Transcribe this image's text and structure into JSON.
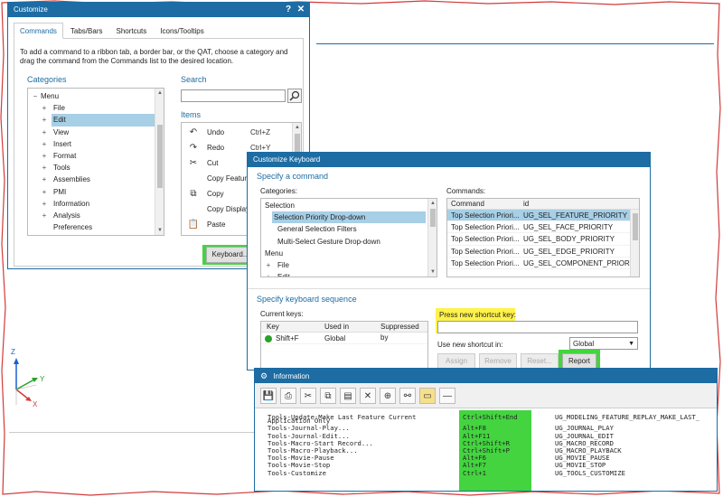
{
  "customize": {
    "title": "Customize",
    "help_btn": "?",
    "close_btn": "✕",
    "tabs": [
      "Commands",
      "Tabs/Bars",
      "Shortcuts",
      "Icons/Tooltips"
    ],
    "instructions": "To add a command to a ribbon tab, a border bar, or the QAT, choose a category and drag the command from the Commands list to the desired location.",
    "categories_header": "Categories",
    "categories": [
      {
        "label": "Menu",
        "indent": 0,
        "expander": "−"
      },
      {
        "label": "File",
        "indent": 1,
        "expander": "+"
      },
      {
        "label": "Edit",
        "indent": 1,
        "expander": "+",
        "selected": true
      },
      {
        "label": "View",
        "indent": 1,
        "expander": "+"
      },
      {
        "label": "Insert",
        "indent": 1,
        "expander": "+"
      },
      {
        "label": "Format",
        "indent": 1,
        "expander": "+"
      },
      {
        "label": "Tools",
        "indent": 1,
        "expander": "+"
      },
      {
        "label": "Assemblies",
        "indent": 1,
        "expander": "+"
      },
      {
        "label": "PMI",
        "indent": 1,
        "expander": "+"
      },
      {
        "label": "Information",
        "indent": 1,
        "expander": "+"
      },
      {
        "label": "Analysis",
        "indent": 1,
        "expander": "+"
      },
      {
        "label": "Preferences",
        "indent": 1,
        "expander": ""
      }
    ],
    "search_header": "Search",
    "search_value": "",
    "items_header": "Items",
    "items": [
      {
        "icon": "↶",
        "icon_name": "undo-icon",
        "label": "Undo",
        "shortcut": "Ctrl+Z"
      },
      {
        "icon": "↷",
        "icon_name": "redo-icon",
        "label": "Redo",
        "shortcut": "Ctrl+Y"
      },
      {
        "icon": "✂",
        "icon_name": "cut-icon",
        "label": "Cut",
        "shortcut": ""
      },
      {
        "icon": "",
        "icon_name": "copy-feature-icon",
        "label": "Copy Feature",
        "shortcut": ""
      },
      {
        "icon": "⧉",
        "icon_name": "copy-icon",
        "label": "Copy",
        "shortcut": ""
      },
      {
        "icon": "",
        "icon_name": "copy-display-icon",
        "label": "Copy Display",
        "shortcut": ""
      },
      {
        "icon": "📋",
        "icon_name": "paste-icon",
        "label": "Paste",
        "shortcut": ""
      }
    ],
    "keyboard_button": "Keyboard..."
  },
  "keyboard": {
    "title": "Customize Keyboard",
    "specify_command": "Specify a command",
    "categories_label": "Categories:",
    "categories": [
      {
        "label": "Selection",
        "indent": 0
      },
      {
        "label": "Selection Priority Drop-down",
        "indent": 1,
        "selected": true
      },
      {
        "label": "General Selection Filters",
        "indent": 1
      },
      {
        "label": "Multi-Select Gesture Drop-down",
        "indent": 1
      },
      {
        "label": "Menu",
        "indent": 0
      },
      {
        "label": "File",
        "indent": 1,
        "expander": "+"
      },
      {
        "label": "Edit",
        "indent": 1,
        "expander": "+"
      }
    ],
    "commands_label": "Commands:",
    "commands_headers": [
      "Command",
      "id"
    ],
    "commands": [
      {
        "command": "Top Selection Priori...",
        "id": "UG_SEL_FEATURE_PRIORITY",
        "selected": true
      },
      {
        "command": "Top Selection Priori...",
        "id": "UG_SEL_FACE_PRIORITY"
      },
      {
        "command": "Top Selection Priori...",
        "id": "UG_SEL_BODY_PRIORITY"
      },
      {
        "command": "Top Selection Priori...",
        "id": "UG_SEL_EDGE_PRIORITY"
      },
      {
        "command": "Top Selection Priori...",
        "id": "UG_SEL_COMPONENT_PRIOR..."
      }
    ],
    "specify_sequence": "Specify keyboard sequence",
    "current_keys_label": "Current keys:",
    "keys_headers": [
      "Key",
      "Used in",
      "Suppressed by"
    ],
    "keys": [
      {
        "key": "Shift+F",
        "used_in": "Global",
        "suppressed_by": ""
      }
    ],
    "press_new_label": "Press new shortcut key:",
    "new_shortcut_value": "",
    "use_in_label": "Use new shortcut in:",
    "use_in_value": "Global",
    "buttons": {
      "assign": "Assign",
      "remove": "Remove",
      "reset": "Reset...",
      "report": "Report"
    }
  },
  "info": {
    "title": "Information",
    "rows": [
      {
        "name": "Tools-Update-Make Last Feature Current",
        "key": "Ctrl+Shift+End",
        "id": "UG_MODELING_FEATURE_REPLAY_MAKE_LAST_"
      },
      {
        "name": "Application Only",
        "key": "",
        "id": ""
      },
      {
        "name": "Tools-Journal-Play...",
        "key": "Alt+F8",
        "id": "UG_JOURNAL_PLAY"
      },
      {
        "name": "Tools-Journal-Edit...",
        "key": "Alt+F11",
        "id": "UG_JOURNAL_EDIT"
      },
      {
        "name": "Tools-Macro-Start Record...",
        "key": "Ctrl+Shift+R",
        "id": "UG_MACRO_RECORD"
      },
      {
        "name": "Tools-Macro-Playback...",
        "key": "Ctrl+Shift+P",
        "id": "UG_MACRO_PLAYBACK"
      },
      {
        "name": "Tools-Movie-Pause",
        "key": "Alt+F6",
        "id": "UG_MOVIE_PAUSE"
      },
      {
        "name": "Tools-Movie-Stop",
        "key": "Alt+F7",
        "id": "UG_MOVIE_STOP"
      },
      {
        "name": "Tools-Customize",
        "key": "Ctrl+1",
        "id": "UG_TOOLS_CUSTOMIZE"
      }
    ]
  },
  "axes": {
    "x": "X",
    "y": "Y",
    "z": "Z"
  }
}
